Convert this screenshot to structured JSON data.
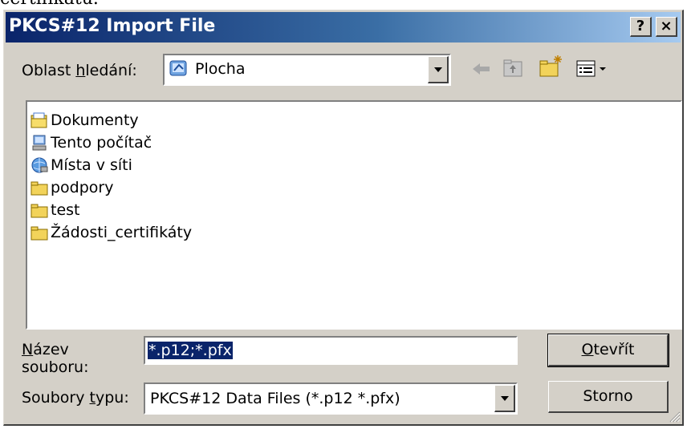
{
  "above_text": "certifikátu.",
  "window": {
    "title": "PKCS#12 Import File",
    "help_button": "?",
    "close_button": "×"
  },
  "lookin": {
    "label_pre": "Oblast ",
    "label_accel": "h",
    "label_post": "ledání:",
    "value": "Plocha",
    "value_icon": "desktop-icon"
  },
  "toolbar": {
    "icons": [
      "back-arrow-icon",
      "up-folder-icon",
      "new-folder-icon",
      "view-menu-icon"
    ]
  },
  "files": [
    {
      "name": "Dokumenty",
      "icon": "my-documents-icon"
    },
    {
      "name": "Tento počítač",
      "icon": "my-computer-icon"
    },
    {
      "name": "Místa v síti",
      "icon": "network-places-icon"
    },
    {
      "name": "podpory",
      "icon": "folder-icon"
    },
    {
      "name": "test",
      "icon": "folder-icon"
    },
    {
      "name": "Žádosti_certifikáty",
      "icon": "folder-icon"
    }
  ],
  "filename": {
    "label_accel": "N",
    "label_line1_post": "ázev",
    "label_line2": "souboru:",
    "value": "*.p12;*.pfx"
  },
  "filetype": {
    "label_pre": "Soubory ",
    "label_accel": "t",
    "label_post": "ypu:",
    "value": "PKCS#12 Data Files (*.p12 *.pfx)"
  },
  "buttons": {
    "open_accel": "O",
    "open_rest": "tevřít",
    "cancel": "Storno"
  },
  "colors": {
    "title_start": "#0a246a",
    "title_end": "#a6caf0",
    "face": "#d4d0c8",
    "selection": "#0a246a"
  }
}
